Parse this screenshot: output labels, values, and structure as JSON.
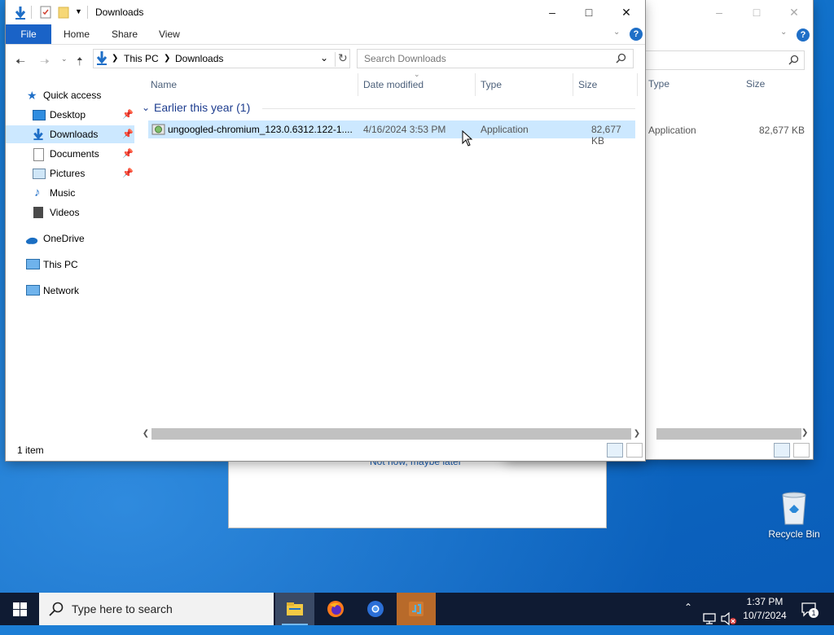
{
  "window": {
    "title": "Downloads",
    "ribbon_tabs": [
      "File",
      "Home",
      "Share",
      "View"
    ],
    "address": {
      "root": "This PC",
      "folder": "Downloads"
    },
    "search_placeholder": "Search Downloads",
    "status_count": "1 item"
  },
  "nav_pane": {
    "items": [
      {
        "label": "Quick access"
      },
      {
        "label": "Desktop"
      },
      {
        "label": "Downloads"
      },
      {
        "label": "Documents"
      },
      {
        "label": "Pictures"
      },
      {
        "label": "Music"
      },
      {
        "label": "Videos"
      },
      {
        "label": "OneDrive"
      },
      {
        "label": "This PC"
      },
      {
        "label": "Network"
      }
    ]
  },
  "file_list": {
    "columns": [
      "Name",
      "Date modified",
      "Type",
      "Size"
    ],
    "group_label": "Earlier this year (1)",
    "rows": [
      {
        "name": "ungoogled-chromium_123.0.6312.122-1....",
        "date": "4/16/2024 3:53 PM",
        "type": "Application",
        "size": "82,677 KB"
      }
    ]
  },
  "back_window": {
    "columns": [
      "Type",
      "Size"
    ],
    "row": {
      "type": "Application",
      "size": "82,677 KB"
    }
  },
  "background_dialog": {
    "link": "Not now, maybe later"
  },
  "desktop": {
    "recycle_bin_label": "Recycle Bin"
  },
  "taskbar": {
    "search_placeholder": "Type here to search",
    "time": "1:37 PM",
    "date": "10/7/2024",
    "notification_count": "1"
  },
  "colors": {
    "accent": "#1a63c7",
    "selection": "#cce8ff",
    "taskbar": "#0f1b33",
    "group_header": "#1e3d8f"
  }
}
